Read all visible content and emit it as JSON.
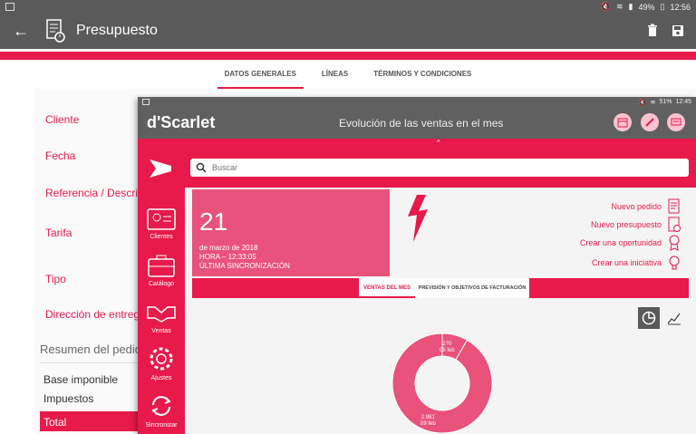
{
  "background_app": {
    "status_bar": {
      "battery": "49%",
      "time": "12:56"
    },
    "toolbar": {
      "title": "Presupuesto"
    },
    "tabs": [
      {
        "label": "DATOS GENERALES",
        "active": true
      },
      {
        "label": "LÍNEAS",
        "active": false
      },
      {
        "label": "TÉRMINOS Y CONDICIONES",
        "active": false
      }
    ],
    "fields": [
      "Cliente",
      "Fecha",
      "Referencia / Descripc",
      "Tarifa",
      "Tipo",
      "Dirección de entrega"
    ],
    "summary": {
      "title": "Resumen del pedid",
      "rows": [
        "Base imponible",
        "Impuestos"
      ],
      "total": "Total"
    }
  },
  "foreground_app": {
    "status_bar": {
      "battery": "51%",
      "time": "12:45"
    },
    "logo": "d'Scarlet",
    "title": "Evolución de las ventas en el mes",
    "sidebar": [
      {
        "label": "Clientes",
        "icon": "contact-card-icon"
      },
      {
        "label": "Catálogo",
        "icon": "briefcase-icon"
      },
      {
        "label": "Ventas",
        "icon": "handshake-icon"
      },
      {
        "label": "Ajustes",
        "icon": "gear-icon"
      },
      {
        "label": "Sincronizar",
        "icon": "sync-icon"
      }
    ],
    "search": {
      "placeholder": "Buscar"
    },
    "date_card": {
      "day": "21",
      "date": "de marzo de 2018",
      "time": "HORA – 12:33:05",
      "sync": "ÚLTIMA SINCRONIZACIÓN"
    },
    "actions": [
      {
        "label": "Nuevo pedido",
        "icon": "order-doc-icon"
      },
      {
        "label": "Nuevo presupuesto",
        "icon": "quote-doc-icon"
      },
      {
        "label": "Crear una oportunidad",
        "icon": "ribbon-icon"
      },
      {
        "label": "Crear una iniciativa",
        "icon": "lightbulb-icon"
      }
    ],
    "tabs": [
      {
        "label": "VENTAS DEL MES",
        "active": true
      },
      {
        "label": "PREVISIÓN Y OBJETIVOS DE FACTURACIÓN",
        "active": false
      }
    ],
    "colors": {
      "accent": "#e8194b",
      "donut": "#e9527a",
      "chrome": "#606060"
    }
  },
  "chart_data": {
    "type": "pie",
    "slices": [
      {
        "value": 270,
        "label": "05 feb"
      },
      {
        "value": 2981,
        "label": "09 feb"
      }
    ],
    "value_labels": [
      "270",
      "2.981"
    ]
  }
}
